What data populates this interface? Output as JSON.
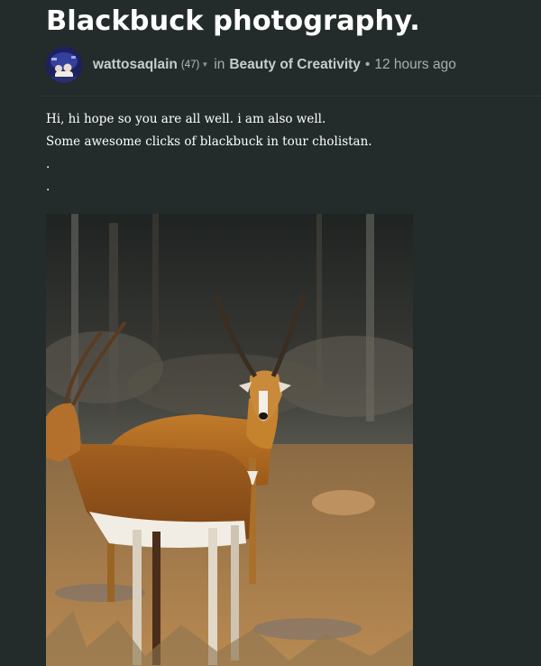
{
  "post": {
    "title": "Blackbuck photography.",
    "author": "wattosaqlain",
    "reputation": "(47)",
    "in_word": "in",
    "community": "Beauty of Creativity",
    "separator": "•",
    "time_ago": "12 hours ago",
    "body_lines": [
      "Hi, hi hope so you are all well. i am also well.",
      "Some awesome clicks of blackbuck in tour cholistan.",
      ".",
      "."
    ]
  },
  "icons": {
    "avatar": "user-avatar-image",
    "caret": "caret-down-icon",
    "photo": "blackbuck-photo"
  },
  "colors": {
    "background": "#232b2b",
    "title": "#ffffff",
    "meta": "#a7b0b0",
    "author": "#c6cdcd",
    "divider": "#2d3636"
  }
}
